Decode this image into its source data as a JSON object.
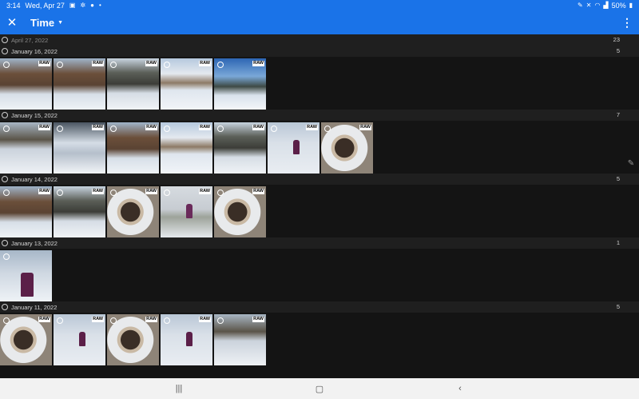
{
  "status_bar": {
    "time": "3:14",
    "date": "Wed, Apr 27",
    "battery": "50%",
    "icons": [
      "image-icon",
      "settings-icon",
      "bulb-icon",
      "dot-icon",
      "pen-icon",
      "mute-icon",
      "wifi-icon",
      "signal-icon",
      "battery-icon"
    ]
  },
  "app_bar": {
    "title": "Time",
    "accent_color": "#1a73e8"
  },
  "groups": [
    {
      "date": "April 27, 2022",
      "count": "23",
      "photos": []
    },
    {
      "date": "January 16, 2022",
      "count": "5",
      "photos": [
        {
          "scene": "house",
          "raw": "RAW"
        },
        {
          "scene": "house",
          "raw": "RAW"
        },
        {
          "scene": "forest",
          "raw": "RAW"
        },
        {
          "scene": "snow",
          "raw": "RAW"
        },
        {
          "scene": "sky",
          "raw": "RAW"
        }
      ]
    },
    {
      "date": "January 15, 2022",
      "count": "7",
      "photos": [
        {
          "scene": "hill",
          "raw": "RAW"
        },
        {
          "scene": "dark",
          "raw": "RAW"
        },
        {
          "scene": "house",
          "raw": "RAW"
        },
        {
          "scene": "snow",
          "raw": "RAW"
        },
        {
          "scene": "forest",
          "raw": "RAW"
        },
        {
          "scene": "person",
          "raw": "RAW"
        },
        {
          "scene": "pan",
          "raw": "RAW"
        }
      ]
    },
    {
      "date": "January 14, 2022",
      "count": "5",
      "photos": [
        {
          "scene": "house",
          "raw": "RAW"
        },
        {
          "scene": "forest",
          "raw": "RAW"
        },
        {
          "scene": "pan",
          "raw": "RAW"
        },
        {
          "scene": "fog",
          "raw": "RAW"
        },
        {
          "scene": "pan",
          "raw": "RAW"
        }
      ]
    },
    {
      "date": "January 13, 2022",
      "count": "1",
      "photos": [
        {
          "scene": "portrait",
          "raw": ""
        }
      ]
    },
    {
      "date": "January 11, 2022",
      "count": "5",
      "photos": [
        {
          "scene": "pan",
          "raw": "RAW"
        },
        {
          "scene": "person",
          "raw": "RAW"
        },
        {
          "scene": "pan",
          "raw": "RAW"
        },
        {
          "scene": "person",
          "raw": "RAW"
        },
        {
          "scene": "hill",
          "raw": "RAW"
        }
      ]
    }
  ]
}
